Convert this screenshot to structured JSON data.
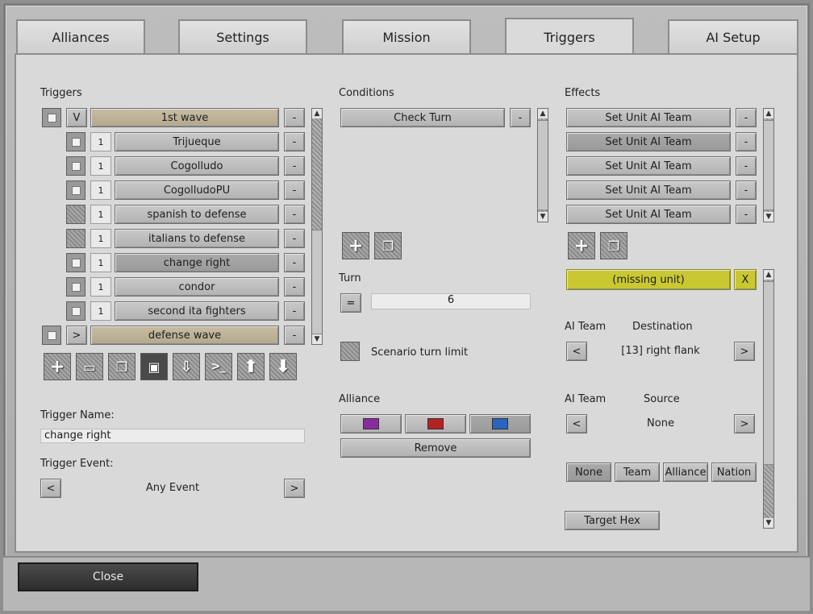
{
  "tabs": [
    {
      "label": "Alliances"
    },
    {
      "label": "Settings"
    },
    {
      "label": "Mission"
    },
    {
      "label": "Triggers"
    },
    {
      "label": "AI Setup"
    }
  ],
  "triggers": {
    "section_label": "Triggers",
    "groups": [
      {
        "toggle": "V",
        "name": "1st wave",
        "remove": "-"
      },
      {
        "toggle": ">",
        "name": "defense wave",
        "remove": "-"
      }
    ],
    "items": [
      {
        "count": "1",
        "name": "Trijueque",
        "remove": "-"
      },
      {
        "count": "1",
        "name": "Cogolludo",
        "remove": "-"
      },
      {
        "count": "1",
        "name": "CogolludoPU",
        "remove": "-"
      },
      {
        "count": "1",
        "name": "spanish to defense",
        "remove": "-"
      },
      {
        "count": "1",
        "name": "italians to defense",
        "remove": "-"
      },
      {
        "count": "1",
        "name": "change right",
        "remove": "-"
      },
      {
        "count": "1",
        "name": "condor",
        "remove": "-"
      },
      {
        "count": "1",
        "name": "second ita fighters",
        "remove": "-"
      }
    ],
    "name_label": "Trigger Name:",
    "name_value": "change right",
    "event_label": "Trigger Event:",
    "event_value": "Any Event",
    "prev": "<",
    "next": ">"
  },
  "conditions": {
    "section_label": "Conditions",
    "items": [
      {
        "name": "Check Turn",
        "remove": "-"
      }
    ],
    "turn_label": "Turn",
    "turn_op": "=",
    "turn_value": "6",
    "scenario_limit_label": "Scenario turn limit",
    "alliance_label": "Alliance",
    "alliance_colors": [
      "#8a2aa0",
      "#b32222",
      "#2a63c0"
    ],
    "remove_label": "Remove"
  },
  "effects": {
    "section_label": "Effects",
    "items": [
      {
        "name": "Set Unit AI Team",
        "remove": "-"
      },
      {
        "name": "Set Unit AI Team",
        "remove": "-"
      },
      {
        "name": "Set Unit AI Team",
        "remove": "-"
      },
      {
        "name": "Set Unit AI Team",
        "remove": "-"
      },
      {
        "name": "Set Unit AI Team",
        "remove": "-"
      }
    ],
    "unit_label": "(missing unit)",
    "unit_remove": "X",
    "ai_team_label": "AI Team",
    "destination_label": "Destination",
    "destination_value": "[13] right flank",
    "ai_team_label_2": "AI Team",
    "source_label": "Source",
    "source_value": "None",
    "prev": "<",
    "next": ">",
    "filters": [
      "None",
      "Team",
      "Alliance",
      "Nation"
    ],
    "target_hex_label": "Target Hex"
  },
  "footer": {
    "close_label": "Close"
  }
}
